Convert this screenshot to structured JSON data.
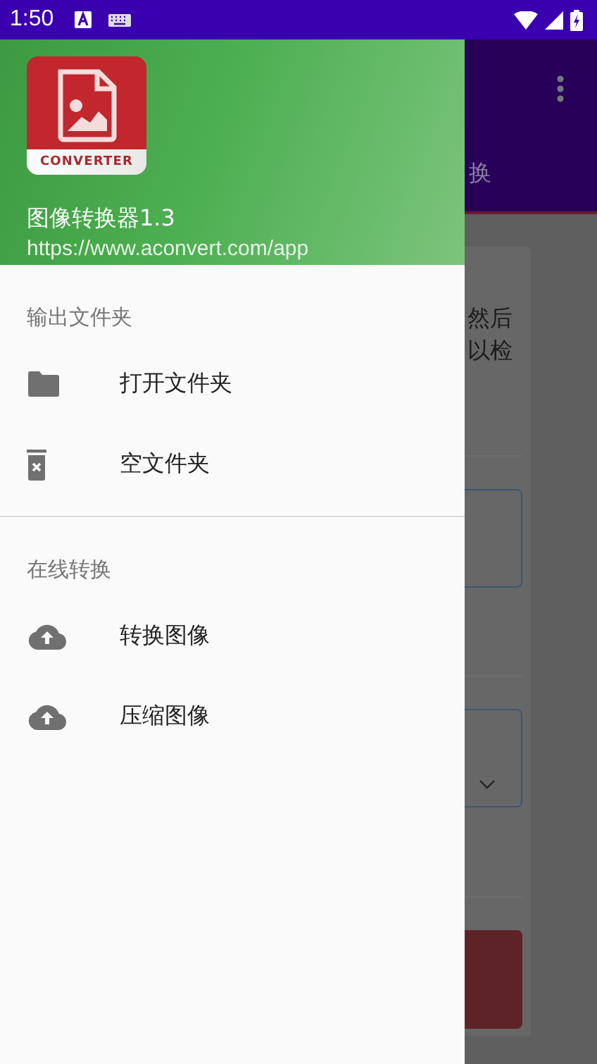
{
  "status_bar": {
    "time": "1:50"
  },
  "drawer": {
    "logo_text": "CONVERTER",
    "app_name": "图像转换器1.3",
    "url": "https://www.aconvert.com/app",
    "sections": [
      {
        "title": "输出文件夹",
        "items": [
          {
            "label": "打开文件夹",
            "kind": "folder"
          },
          {
            "label": "空文件夹",
            "kind": "trash"
          }
        ]
      },
      {
        "title": "在线转换",
        "items": [
          {
            "label": "转换图像",
            "kind": "upload"
          },
          {
            "label": "压缩图像",
            "kind": "upload"
          }
        ]
      }
    ]
  },
  "background": {
    "tab": "换",
    "text_lines": [
      "然后",
      "以检"
    ]
  }
}
